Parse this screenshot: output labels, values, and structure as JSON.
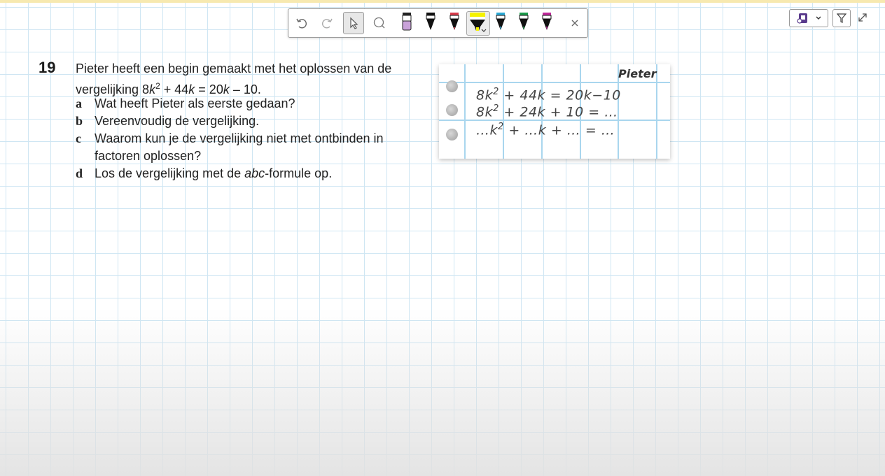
{
  "toolbar": {
    "tools": [
      "undo-icon",
      "redo-icon",
      "select-pointer-icon",
      "lasso-icon"
    ],
    "pens": [
      {
        "name": "pen-pink-icon",
        "color": "#c9a2d9"
      },
      {
        "name": "pen-black-icon",
        "color": "#111111"
      },
      {
        "name": "pen-red-icon",
        "color": "#d83a4a"
      },
      {
        "name": "highlighter-yellow-icon",
        "color": "#f5f200"
      },
      {
        "name": "pen-blue-icon",
        "color": "#2aa9d6"
      },
      {
        "name": "pen-green-icon",
        "color": "#1a9a4a"
      },
      {
        "name": "pen-magenta-icon",
        "color": "#c0289a"
      }
    ],
    "close_icon": "close-icon"
  },
  "controls": {
    "app_icon": "app-indicator-icon",
    "filter_icon": "funnel-icon",
    "expand_icon": "expand-icon"
  },
  "exercise": {
    "number": "19",
    "intro_line1": "Pieter heeft een begin gemaakt met het oplossen van de",
    "intro_line2_prefix": "vergelijking 8",
    "var": "k",
    "exp": "2",
    "intro_line2_mid1": " + 44",
    "intro_line2_mid2": " = 20",
    "intro_line2_suffix": " – 10.",
    "parts": [
      {
        "letter": "a",
        "text": "Wat heeft Pieter als eerste gedaan?"
      },
      {
        "letter": "b",
        "text": "Vereenvoudig de vergelijking."
      },
      {
        "letter": "c",
        "text": "Waarom kun je de vergelijking niet met ontbinden in"
      },
      {
        "letter": "",
        "text": "factoren oplossen?"
      },
      {
        "letter": "d",
        "text_prefix": "Los de vergelijking met de ",
        "text_italic": "abc",
        "text_suffix": "-formule op."
      }
    ]
  },
  "notebook": {
    "name": "Pieter",
    "line1_a": "8k",
    "line1_sup": "2",
    "line1_b": " + 44k = 20k−10",
    "line2_a": "8k",
    "line2_sup": "2",
    "line2_b": " + 24k + 10 = …",
    "line3_a": "…k",
    "line3_sup": "2",
    "line3_b": " + …k + … = …"
  }
}
